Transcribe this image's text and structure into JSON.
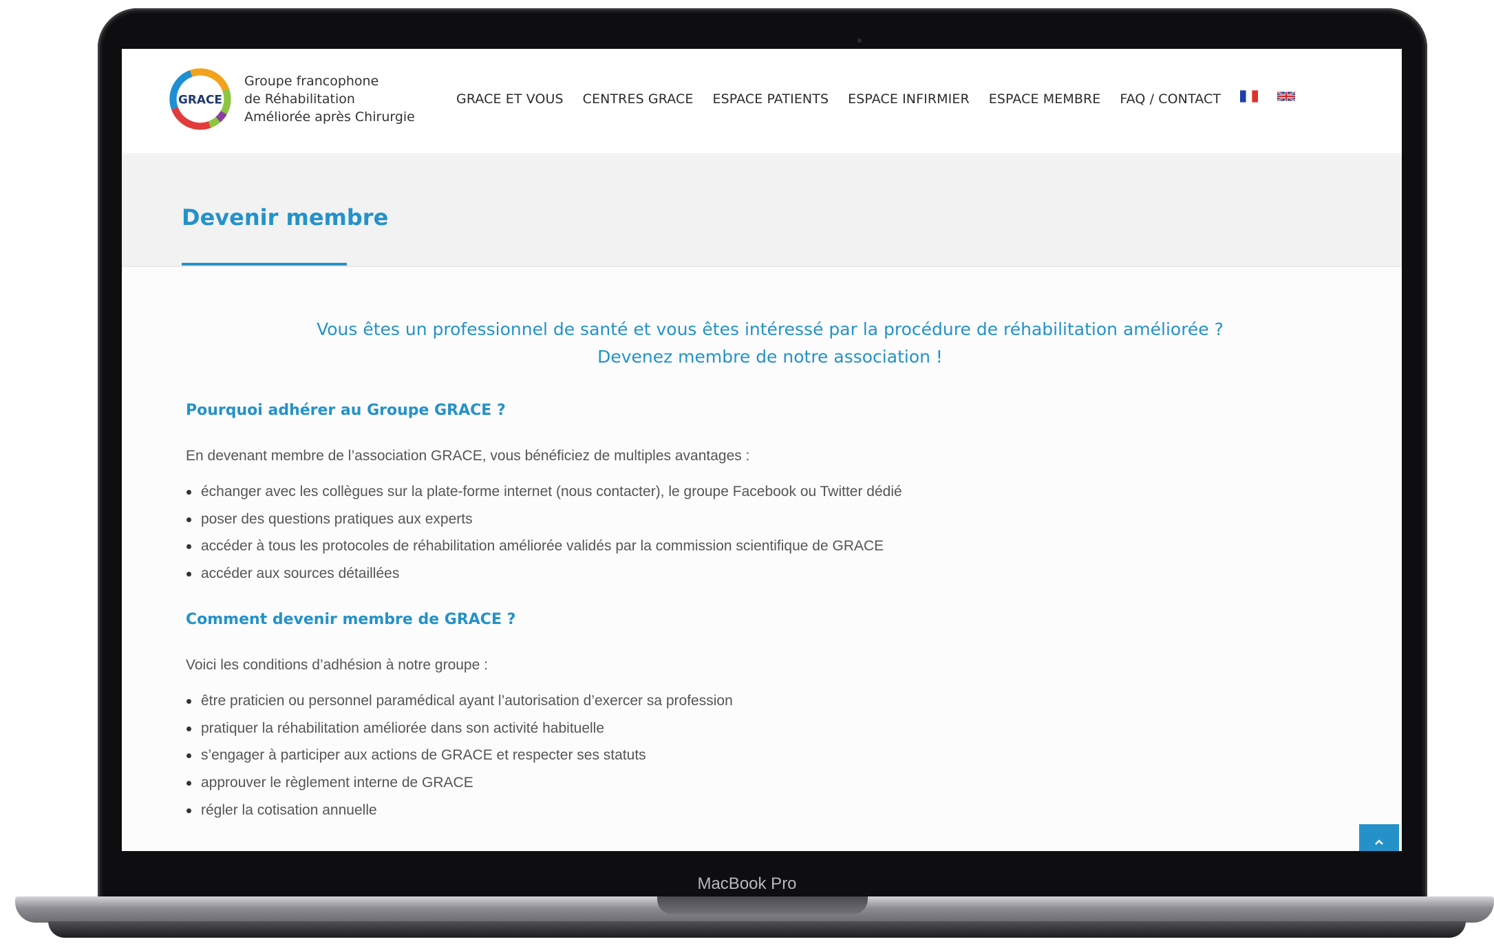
{
  "device": {
    "label": "MacBook Pro"
  },
  "header": {
    "logo_badge": "GRACE",
    "logo_lines": [
      "Groupe francophone",
      "de Réhabilitation",
      "Améliorée après Chirurgie"
    ],
    "nav": [
      "GRACE ET VOUS",
      "CENTRES GRACE",
      "ESPACE PATIENTS",
      "ESPACE INFIRMIER",
      "ESPACE MEMBRE",
      "FAQ / CONTACT"
    ],
    "languages": [
      "fr-flag-icon",
      "uk-flag-icon"
    ]
  },
  "page": {
    "title": "Devenir membre",
    "lead": [
      "Vous êtes un professionnel de santé et vous êtes intéressé par la procédure de réhabilitation améliorée ?",
      "Devenez membre de notre association !"
    ],
    "section1": {
      "heading": "Pourquoi adhérer au Groupe GRACE ?",
      "intro": "En devenant membre de l’association GRACE, vous bénéficiez de multiples avantages :",
      "items": [
        "échanger avec les collègues sur la plate-forme internet (nous contacter), le groupe Facebook  ou Twitter dédié",
        "poser des questions pratiques aux experts",
        "accéder à tous les protocoles de réhabilitation améliorée validés par la commission scientifique de GRACE",
        "accéder aux sources détaillées"
      ]
    },
    "section2": {
      "heading": "Comment devenir membre de GRACE ?",
      "intro": "Voici les conditions d’adhésion à notre groupe :",
      "items": [
        "être praticien ou personnel paramédical ayant l’autorisation d’exercer sa profession",
        "pratiquer la réhabilitation améliorée dans son activité habituelle",
        "s’engager à participer aux actions de GRACE et respecter ses statuts",
        "approuver le règlement interne de GRACE",
        "régler la cotisation annuelle"
      ]
    }
  },
  "colors": {
    "accent": "#2492c9",
    "body_text": "#555555",
    "nav_text": "#2c2c2c",
    "band_bg": "#f2f2f3"
  },
  "icons": {
    "scroll_top": "chevron-up-icon"
  }
}
